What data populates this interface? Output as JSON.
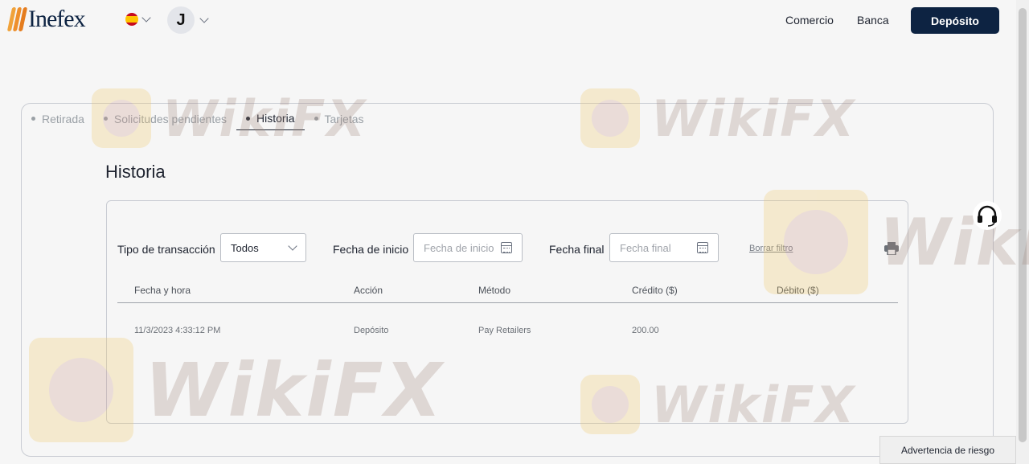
{
  "header": {
    "logo_text": "Inefex",
    "avatar_initial": "J",
    "nav": [
      {
        "label": "Comercio"
      },
      {
        "label": "Banca"
      }
    ],
    "deposit_label": "Depósito"
  },
  "tabs": [
    {
      "label": "Retirada",
      "active": false
    },
    {
      "label": "Solicitudes pendientes",
      "active": false
    },
    {
      "label": "Historia",
      "active": true
    },
    {
      "label": "Tarjetas",
      "active": false
    }
  ],
  "page_title": "Historia",
  "filters": {
    "type_label": "Tipo de transacción",
    "type_value": "Todos",
    "start_label": "Fecha de inicio",
    "start_placeholder": "Fecha de inicio",
    "end_label": "Fecha final",
    "end_placeholder": "Fecha final",
    "clear_label": "Borrar filtro"
  },
  "table": {
    "headers": [
      "Fecha y hora",
      "Acción",
      "Método",
      "Crédito ($)",
      "Débito ($)"
    ],
    "rows": [
      [
        "11/3/2023 4:33:12 PM",
        "Depósito",
        "Pay Retailers",
        "200.00",
        ""
      ]
    ]
  },
  "risk_warning": "Advertencia de riesgo",
  "watermark_text": "WikiFX",
  "colors": {
    "primary": "#0d2342",
    "logo_orange": "#ee8f2b",
    "border": "#c9ccd3"
  }
}
